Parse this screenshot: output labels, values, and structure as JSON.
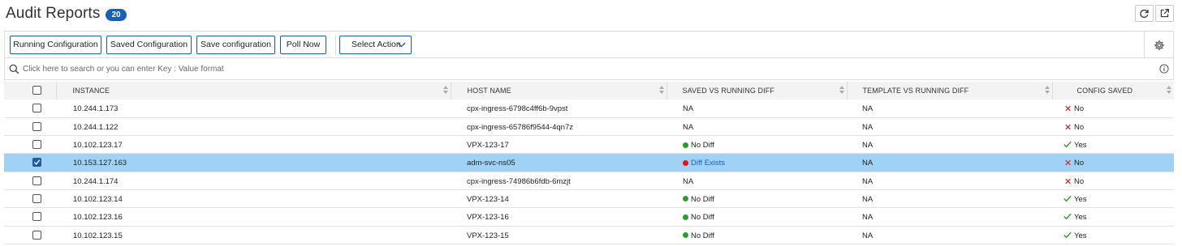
{
  "header": {
    "title": "Audit Reports",
    "count": "20",
    "refresh_icon": "refresh-icon",
    "popout_icon": "external-link-icon"
  },
  "toolbar": {
    "running_config": "Running Configuration",
    "saved_config": "Saved Configuration",
    "save_config": "Save configuration",
    "poll_now": "Poll Now",
    "select_action": "Select Action",
    "settings_icon": "gear-icon"
  },
  "search": {
    "placeholder": "Click here to search or you can enter Key : Value format",
    "info_icon": "info-icon"
  },
  "table": {
    "columns": [
      "INSTANCE",
      "HOST NAME",
      "SAVED VS RUNNING DIFF",
      "TEMPLATE VS RUNNING DIFF",
      "CONFIG SAVED"
    ],
    "rows": [
      {
        "instance": "10.244.1.173",
        "host": "cpx-ingress-6798c4ff6b-9vpst",
        "saved_diff": "NA",
        "saved_status": "none",
        "template_diff": "NA",
        "config_saved": "No",
        "selected": false
      },
      {
        "instance": "10.244.1.122",
        "host": "cpx-ingress-65786f9544-4qn7z",
        "saved_diff": "NA",
        "saved_status": "none",
        "template_diff": "NA",
        "config_saved": "No",
        "selected": false
      },
      {
        "instance": "10.102.123.17",
        "host": "VPX-123-17",
        "saved_diff": "No Diff",
        "saved_status": "ok",
        "template_diff": "NA",
        "config_saved": "Yes",
        "selected": false
      },
      {
        "instance": "10.153.127.163",
        "host": "adm-svc-ns05",
        "saved_diff": "Diff Exists",
        "saved_status": "diff",
        "template_diff": "NA",
        "config_saved": "No",
        "selected": true
      },
      {
        "instance": "10.244.1.174",
        "host": "cpx-ingress-74986b6fdb-6mzjt",
        "saved_diff": "NA",
        "saved_status": "none",
        "template_diff": "NA",
        "config_saved": "No",
        "selected": false
      },
      {
        "instance": "10.102.123.14",
        "host": "VPX-123-14",
        "saved_diff": "No Diff",
        "saved_status": "ok",
        "template_diff": "NA",
        "config_saved": "Yes",
        "selected": false
      },
      {
        "instance": "10.102.123.16",
        "host": "VPX-123-16",
        "saved_diff": "No Diff",
        "saved_status": "ok",
        "template_diff": "NA",
        "config_saved": "Yes",
        "selected": false
      },
      {
        "instance": "10.102.123.15",
        "host": "VPX-123-15",
        "saved_diff": "No Diff",
        "saved_status": "ok",
        "template_diff": "NA",
        "config_saved": "Yes",
        "selected": false
      }
    ]
  },
  "colors": {
    "accent": "#1f5ba3",
    "selected_row": "#9fd2f5",
    "ok": "#2e9b2e",
    "diff": "#e11111",
    "no_mark": "#d9272e",
    "yes_mark": "#2e9b2e"
  }
}
